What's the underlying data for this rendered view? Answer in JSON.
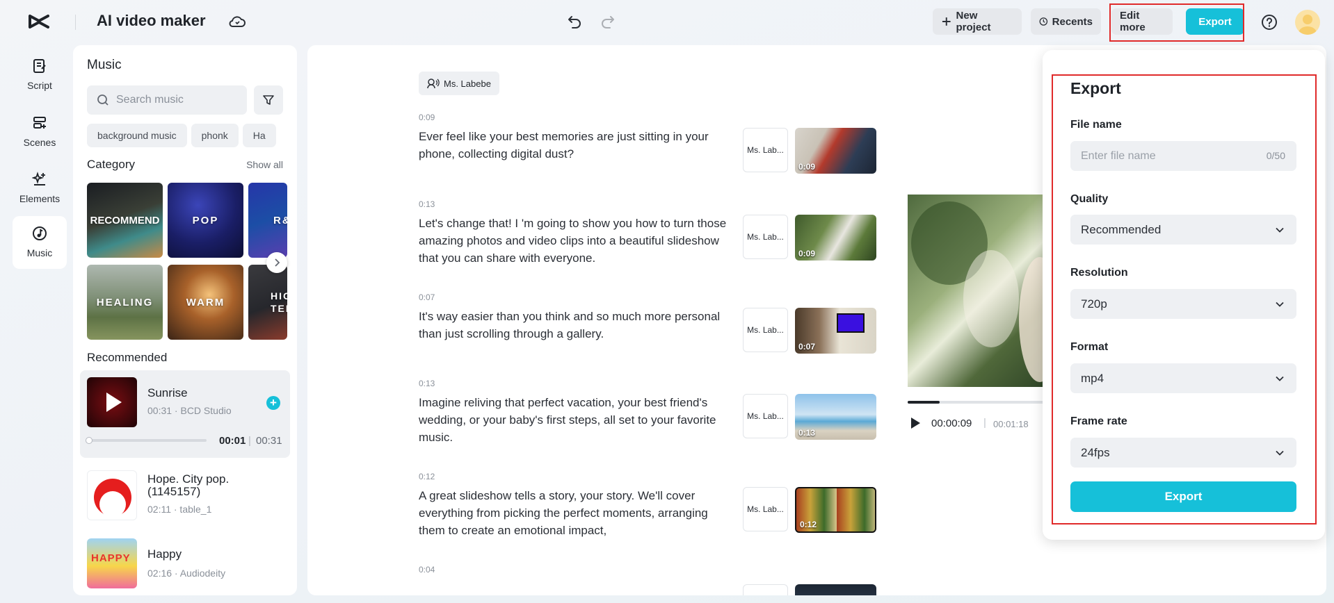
{
  "header": {
    "app_title": "AI video maker",
    "new_project_label": "New project",
    "recents_label": "Recents",
    "edit_more_label": "Edit more",
    "export_label": "Export"
  },
  "nav": {
    "items": [
      {
        "label": "Script",
        "icon": "script-icon"
      },
      {
        "label": "Scenes",
        "icon": "scenes-icon"
      },
      {
        "label": "Elements",
        "icon": "elements-icon"
      },
      {
        "label": "Music",
        "icon": "music-icon",
        "active": true
      }
    ]
  },
  "music": {
    "title": "Music",
    "search_placeholder": "Search music",
    "chips": [
      "background music",
      "phonk",
      "Ha"
    ],
    "category_title": "Category",
    "show_all": "Show all",
    "categories": [
      "RECOMMEND",
      "POP",
      "R&",
      "HEALING",
      "WARM",
      "HIG TEM"
    ],
    "recommended_title": "Recommended",
    "songs": [
      {
        "title": "Sunrise",
        "subtitle": "00:31 · BCD Studio",
        "current": "00:01",
        "total": "00:31",
        "progress": 0.02
      },
      {
        "title": "Hope. City pop. (1145157)",
        "subtitle": "02:11 · table_1"
      },
      {
        "title": "Happy",
        "subtitle": "02:16 · Audiodeity",
        "cover_text": "HAPPY"
      }
    ]
  },
  "script": {
    "speaker": "Ms. Labebe",
    "scenes": [
      {
        "time": "0:09",
        "text": "Ever feel like your best memories are just sitting in your phone, collecting digital dust?",
        "voice": "Ms. Lab...",
        "duration": "0:09"
      },
      {
        "time": "0:13",
        "text": "Let's change that! I 'm going to show you how to turn those amazing photos and video clips into a beautiful slideshow that you can share with everyone.",
        "voice": "Ms. Lab...",
        "duration": "0:09"
      },
      {
        "time": "0:07",
        "text": "It's way easier than you think and so much more personal than just scrolling through a gallery.",
        "voice": "Ms. Lab...",
        "duration": "0:07"
      },
      {
        "time": "0:13",
        "text": "Imagine reliving that perfect vacation, your best friend's wedding, or your baby's first steps, all set to your favorite music.",
        "voice": "Ms. Lab...",
        "duration": "0:13"
      },
      {
        "time": "0:12",
        "text": "A great slideshow tells a story, your story. We'll cover everything from picking the perfect moments, arranging them to create an emotional impact,",
        "voice": "Ms. Lab...",
        "duration": "0:12"
      },
      {
        "time": "0:04",
        "text": "",
        "voice": "",
        "duration": ""
      }
    ]
  },
  "preview": {
    "current_time": "00:00:09",
    "separator": "|",
    "total_time": "00:01:18",
    "progress": 0.23
  },
  "export_dialog": {
    "title": "Export",
    "file_name_label": "File name",
    "file_name_placeholder": "Enter file name",
    "file_name_count": "0/50",
    "quality_label": "Quality",
    "quality_value": "Recommended",
    "resolution_label": "Resolution",
    "resolution_value": "720p",
    "format_label": "Format",
    "format_value": "mp4",
    "frame_rate_label": "Frame rate",
    "frame_rate_value": "24fps",
    "submit_label": "Export"
  },
  "colors": {
    "accent": "#16c0d9",
    "highlight": "#e02a2a"
  }
}
